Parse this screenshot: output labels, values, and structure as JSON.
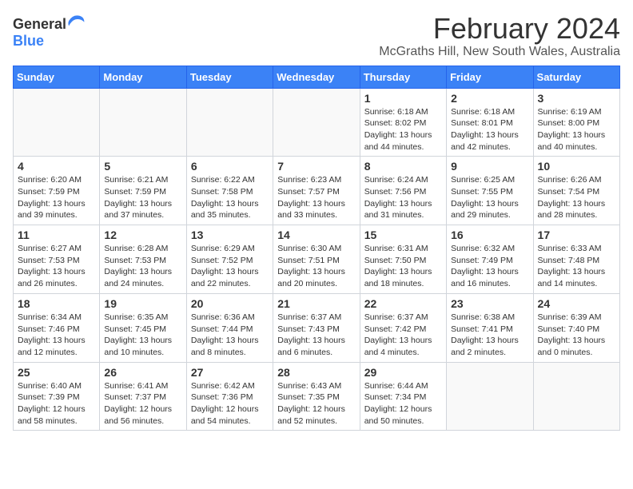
{
  "logo": {
    "general": "General",
    "blue": "Blue"
  },
  "title": "February 2024",
  "subtitle": "McGraths Hill, New South Wales, Australia",
  "header_days": [
    "Sunday",
    "Monday",
    "Tuesday",
    "Wednesday",
    "Thursday",
    "Friday",
    "Saturday"
  ],
  "weeks": [
    [
      {
        "day": "",
        "info": ""
      },
      {
        "day": "",
        "info": ""
      },
      {
        "day": "",
        "info": ""
      },
      {
        "day": "",
        "info": ""
      },
      {
        "day": "1",
        "info": "Sunrise: 6:18 AM\nSunset: 8:02 PM\nDaylight: 13 hours\nand 44 minutes."
      },
      {
        "day": "2",
        "info": "Sunrise: 6:18 AM\nSunset: 8:01 PM\nDaylight: 13 hours\nand 42 minutes."
      },
      {
        "day": "3",
        "info": "Sunrise: 6:19 AM\nSunset: 8:00 PM\nDaylight: 13 hours\nand 40 minutes."
      }
    ],
    [
      {
        "day": "4",
        "info": "Sunrise: 6:20 AM\nSunset: 7:59 PM\nDaylight: 13 hours\nand 39 minutes."
      },
      {
        "day": "5",
        "info": "Sunrise: 6:21 AM\nSunset: 7:59 PM\nDaylight: 13 hours\nand 37 minutes."
      },
      {
        "day": "6",
        "info": "Sunrise: 6:22 AM\nSunset: 7:58 PM\nDaylight: 13 hours\nand 35 minutes."
      },
      {
        "day": "7",
        "info": "Sunrise: 6:23 AM\nSunset: 7:57 PM\nDaylight: 13 hours\nand 33 minutes."
      },
      {
        "day": "8",
        "info": "Sunrise: 6:24 AM\nSunset: 7:56 PM\nDaylight: 13 hours\nand 31 minutes."
      },
      {
        "day": "9",
        "info": "Sunrise: 6:25 AM\nSunset: 7:55 PM\nDaylight: 13 hours\nand 29 minutes."
      },
      {
        "day": "10",
        "info": "Sunrise: 6:26 AM\nSunset: 7:54 PM\nDaylight: 13 hours\nand 28 minutes."
      }
    ],
    [
      {
        "day": "11",
        "info": "Sunrise: 6:27 AM\nSunset: 7:53 PM\nDaylight: 13 hours\nand 26 minutes."
      },
      {
        "day": "12",
        "info": "Sunrise: 6:28 AM\nSunset: 7:53 PM\nDaylight: 13 hours\nand 24 minutes."
      },
      {
        "day": "13",
        "info": "Sunrise: 6:29 AM\nSunset: 7:52 PM\nDaylight: 13 hours\nand 22 minutes."
      },
      {
        "day": "14",
        "info": "Sunrise: 6:30 AM\nSunset: 7:51 PM\nDaylight: 13 hours\nand 20 minutes."
      },
      {
        "day": "15",
        "info": "Sunrise: 6:31 AM\nSunset: 7:50 PM\nDaylight: 13 hours\nand 18 minutes."
      },
      {
        "day": "16",
        "info": "Sunrise: 6:32 AM\nSunset: 7:49 PM\nDaylight: 13 hours\nand 16 minutes."
      },
      {
        "day": "17",
        "info": "Sunrise: 6:33 AM\nSunset: 7:48 PM\nDaylight: 13 hours\nand 14 minutes."
      }
    ],
    [
      {
        "day": "18",
        "info": "Sunrise: 6:34 AM\nSunset: 7:46 PM\nDaylight: 13 hours\nand 12 minutes."
      },
      {
        "day": "19",
        "info": "Sunrise: 6:35 AM\nSunset: 7:45 PM\nDaylight: 13 hours\nand 10 minutes."
      },
      {
        "day": "20",
        "info": "Sunrise: 6:36 AM\nSunset: 7:44 PM\nDaylight: 13 hours\nand 8 minutes."
      },
      {
        "day": "21",
        "info": "Sunrise: 6:37 AM\nSunset: 7:43 PM\nDaylight: 13 hours\nand 6 minutes."
      },
      {
        "day": "22",
        "info": "Sunrise: 6:37 AM\nSunset: 7:42 PM\nDaylight: 13 hours\nand 4 minutes."
      },
      {
        "day": "23",
        "info": "Sunrise: 6:38 AM\nSunset: 7:41 PM\nDaylight: 13 hours\nand 2 minutes."
      },
      {
        "day": "24",
        "info": "Sunrise: 6:39 AM\nSunset: 7:40 PM\nDaylight: 13 hours\nand 0 minutes."
      }
    ],
    [
      {
        "day": "25",
        "info": "Sunrise: 6:40 AM\nSunset: 7:39 PM\nDaylight: 12 hours\nand 58 minutes."
      },
      {
        "day": "26",
        "info": "Sunrise: 6:41 AM\nSunset: 7:37 PM\nDaylight: 12 hours\nand 56 minutes."
      },
      {
        "day": "27",
        "info": "Sunrise: 6:42 AM\nSunset: 7:36 PM\nDaylight: 12 hours\nand 54 minutes."
      },
      {
        "day": "28",
        "info": "Sunrise: 6:43 AM\nSunset: 7:35 PM\nDaylight: 12 hours\nand 52 minutes."
      },
      {
        "day": "29",
        "info": "Sunrise: 6:44 AM\nSunset: 7:34 PM\nDaylight: 12 hours\nand 50 minutes."
      },
      {
        "day": "",
        "info": ""
      },
      {
        "day": "",
        "info": ""
      }
    ]
  ]
}
